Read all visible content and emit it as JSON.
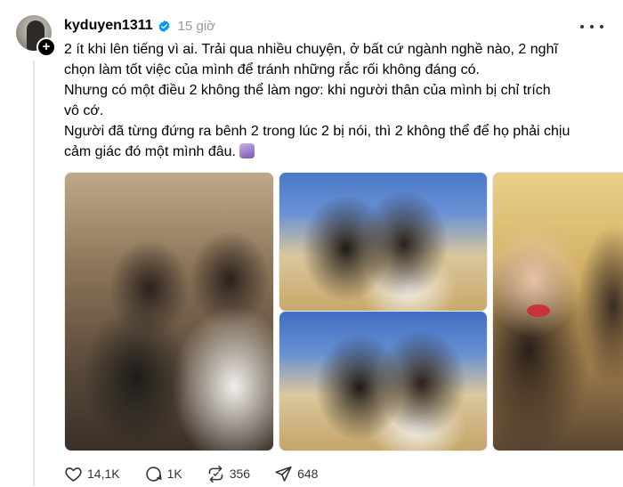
{
  "post": {
    "username": "kyduyen1311",
    "timestamp": "15 giờ",
    "follow_icon": "plus-icon",
    "verified_icon": "verified-badge-icon",
    "more_icon": "more-horizontal-icon",
    "text_lines": [
      "2 ít khi lên tiếng vì ai. Trải qua nhiều chuyện, ở bất cứ ngành nghề nào, 2 nghĩ",
      "chọn làm tốt việc của mình để tránh những rắc rối không đáng có.",
      "Nhưng có một điều 2 không thể làm ngơ: khi người thân của mình bị chỉ trích",
      "vô cớ.",
      "Người đã từng đứng ra bênh 2 trong lúc 2 bị nói, thì 2 không thể để họ phải chịu",
      "cảm giác đó một mình đâu."
    ],
    "emoji_icon": "purple-emoji-icon",
    "photos": [
      {
        "name": "photo-two-women-wine"
      },
      {
        "name": "photo-selfie-top"
      },
      {
        "name": "photo-selfie-bottom"
      },
      {
        "name": "photo-closeup-pout"
      }
    ],
    "actions": {
      "likes": "14,1K",
      "comments": "1K",
      "reposts": "356",
      "shares": "648"
    }
  },
  "colors": {
    "verified_blue": "#0095f6",
    "muted_text": "#999999",
    "thread_line": "#e6e6e6"
  }
}
